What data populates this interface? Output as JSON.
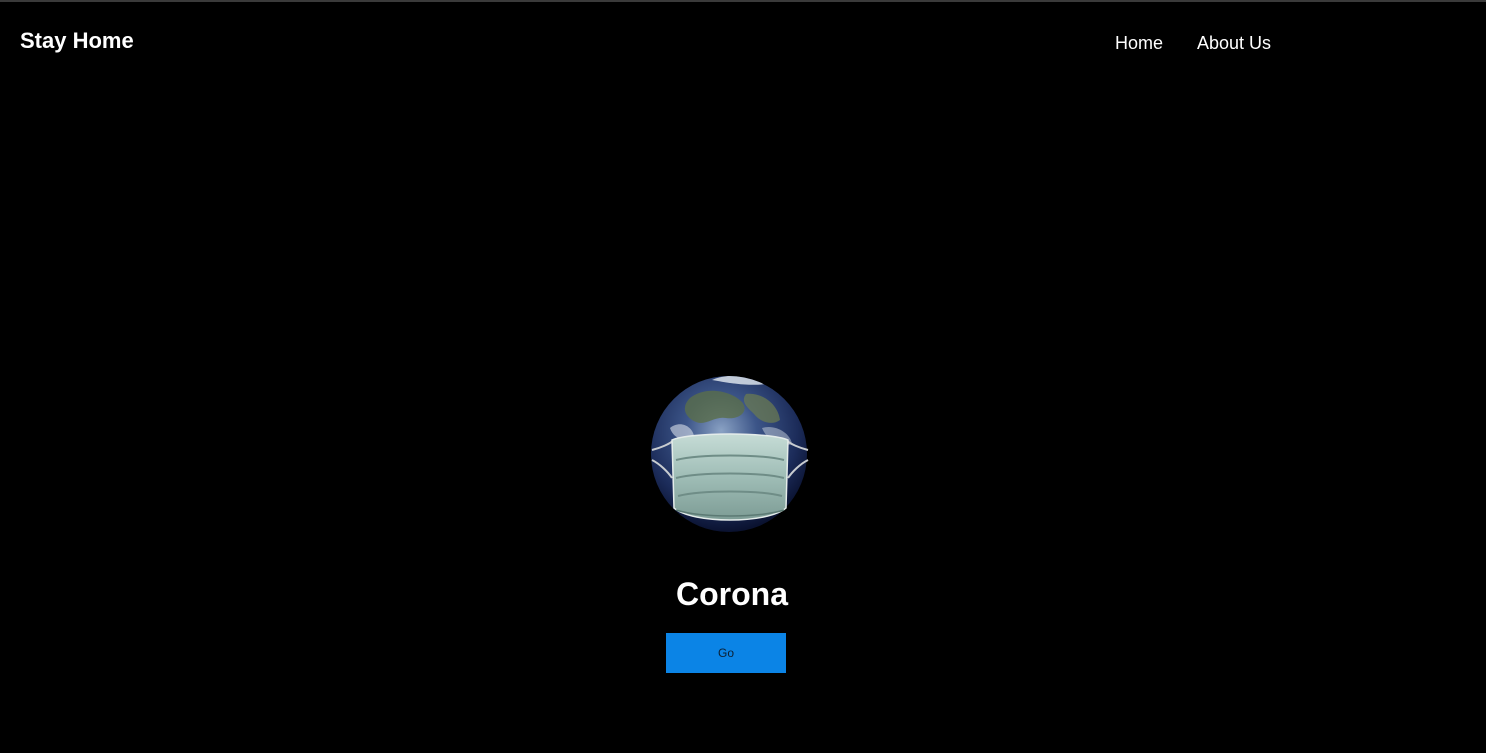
{
  "header": {
    "brand": "Stay Home",
    "nav": [
      {
        "label": "Home"
      },
      {
        "label": "About Us"
      }
    ]
  },
  "hero": {
    "image": "earth-with-face-mask",
    "title": "Corona",
    "button_label": "Go"
  },
  "colors": {
    "background": "#000000",
    "text": "#ffffff",
    "button": "#0b84e6"
  }
}
